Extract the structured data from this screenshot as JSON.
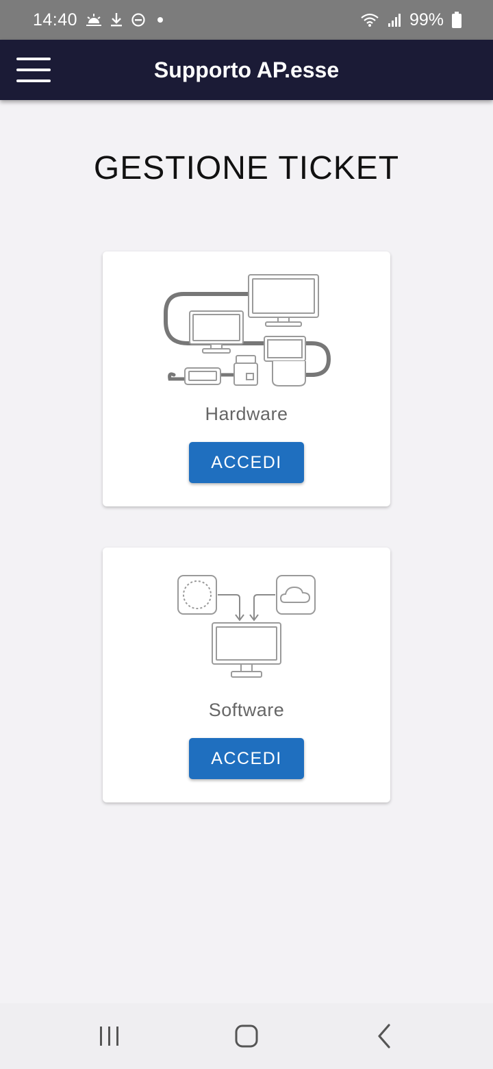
{
  "status_bar": {
    "time": "14:40",
    "battery_percent": "99%",
    "icons": [
      "weather-sunrise-icon",
      "download-icon",
      "do-not-disturb-icon",
      "dot-icon",
      "wifi-icon",
      "signal-icon",
      "battery-icon"
    ]
  },
  "app_bar": {
    "title": "Supporto AP.esse",
    "menu_icon": "hamburger-menu-icon",
    "background_color": "#1b1b36"
  },
  "page": {
    "title": "GESTIONE TICKET"
  },
  "cards": [
    {
      "label": "Hardware",
      "button_label": "ACCEDI",
      "illustration": "hardware-devices-icon"
    },
    {
      "label": "Software",
      "button_label": "ACCEDI",
      "illustration": "software-cloud-monitor-icon"
    }
  ],
  "colors": {
    "accent": "#1f6fbf",
    "page_background": "#f3f2f5"
  },
  "nav_bar": {
    "icons": [
      "recent-apps-icon",
      "home-icon",
      "back-icon"
    ]
  }
}
